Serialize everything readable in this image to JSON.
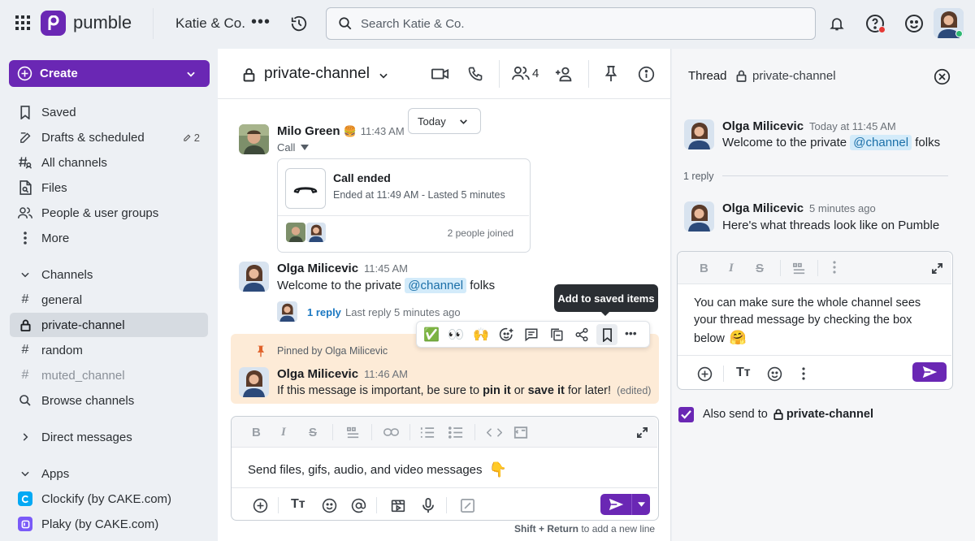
{
  "app": {
    "name": "pumble",
    "workspace": "Katie & Co."
  },
  "search": {
    "placeholder": "Search Katie & Co."
  },
  "sidebar": {
    "create_label": "Create",
    "nav": [
      {
        "label": "Saved",
        "icon": "bookmark-icon"
      },
      {
        "label": "Drafts & scheduled",
        "icon": "edit-icon",
        "count": "2"
      },
      {
        "label": "All channels",
        "icon": "channels-icon"
      },
      {
        "label": "Files",
        "icon": "file-icon"
      },
      {
        "label": "People & user groups",
        "icon": "people-icon"
      },
      {
        "label": "More",
        "icon": "more-vertical-icon"
      }
    ],
    "channels_header": "Channels",
    "channels": [
      {
        "label": "general"
      },
      {
        "label": "private-channel"
      },
      {
        "label": "random"
      },
      {
        "label": "muted_channel"
      },
      {
        "label": "Browse channels"
      }
    ],
    "direct_messages_header": "Direct messages",
    "apps_header": "Apps",
    "apps": [
      {
        "label": "Clockify (by CAKE.com)",
        "color": "#03a9f4"
      },
      {
        "label": "Plaky (by CAKE.com)",
        "color": "#7a5af8"
      }
    ]
  },
  "channel": {
    "name": "private-channel",
    "member_count": "4"
  },
  "date_divider": "Today",
  "messages": [
    {
      "author": "Milo Green",
      "emoji": "🍔",
      "time": "11:43 AM",
      "sub": "Call",
      "call": {
        "title": "Call ended",
        "detail": "Ended at 11:49 AM - Lasted 5 minutes",
        "joined": "2 people joined"
      }
    },
    {
      "author": "Olga Milicevic",
      "time": "11:45 AM",
      "text_before": "Welcome to the private ",
      "mention": "@channel",
      "text_after": " folks",
      "reply_count": "1 reply",
      "last_reply": "Last reply 5 minutes ago"
    },
    {
      "pinned_by": "Pinned by Olga Milicevic",
      "author": "Olga Milicevic",
      "time": "11:46 AM",
      "t1": "If this message is important, be sure to ",
      "b1": "pin it",
      "t2": " or ",
      "b2": "save it",
      "t3": " for later!",
      "edited": "(edited)"
    }
  ],
  "hover_toolbar": {
    "tooltip": "Add to saved items",
    "reactions": [
      "✅",
      "👀",
      "🙌"
    ]
  },
  "composer": {
    "text": "Send files, gifs, audio, and video messages",
    "emoji": "👇",
    "hint_bold": "Shift + Return",
    "hint_rest": " to add a new line"
  },
  "thread": {
    "title": "Thread",
    "channel": "private-channel",
    "root": {
      "author": "Olga Milicevic",
      "time": "Today at 11:45 AM",
      "text_before": "Welcome to the private ",
      "mention": "@channel",
      "text_after": " folks"
    },
    "reply_count": "1 reply",
    "reply": {
      "author": "Olga Milicevic",
      "time": "5 minutes ago",
      "text": "Here's what threads look like on Pumble"
    },
    "draft": {
      "text": "You can make sure the whole channel sees your thread message by checking the box below",
      "emoji": "🤗"
    },
    "also_send_label": "Also send to",
    "also_send_channel": "private-channel",
    "also_send_checked": true
  },
  "colors": {
    "brand": "#6a27b4",
    "pinned_bg": "#fdebd7",
    "mention_bg": "#d3ebfa"
  }
}
